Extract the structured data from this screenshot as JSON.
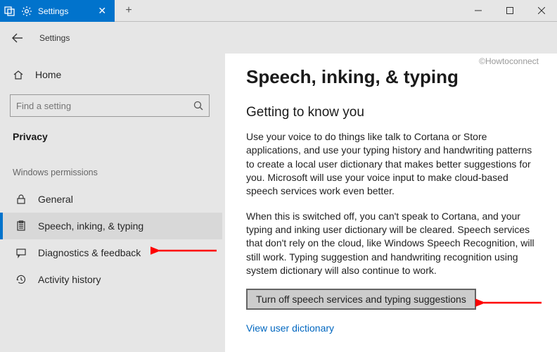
{
  "titlebar": {
    "tab_label": "Settings",
    "new_tab_symbol": "+",
    "min_symbol": "—",
    "max_symbol": "☐",
    "close_symbol": "✕",
    "tab_close_symbol": "✕"
  },
  "topbar": {
    "app_label": "Settings"
  },
  "sidebar": {
    "home_label": "Home",
    "search_placeholder": "Find a setting",
    "section_title": "Privacy",
    "group_label": "Windows permissions",
    "items": [
      {
        "label": "General"
      },
      {
        "label": "Speech, inking, & typing"
      },
      {
        "label": "Diagnostics & feedback"
      },
      {
        "label": "Activity history"
      }
    ]
  },
  "content": {
    "watermark": "©Howtoconnect",
    "h1": "Speech, inking, & typing",
    "h2": "Getting to know you",
    "p1": "Use your voice to do things like talk to Cortana or Store applications, and use your typing history and handwriting patterns to create a local user dictionary that makes better suggestions for you. Microsoft will use your voice input to make cloud-based speech services work even better.",
    "p2": "When this is switched off, you can't speak to Cortana, and your typing and inking user dictionary will be cleared. Speech services that don't rely on the cloud, like Windows Speech Recognition, will still work. Typing suggestion and handwriting recognition using system dictionary will also continue to work.",
    "button_label": "Turn off speech services and typing suggestions",
    "link_label": "View user dictionary"
  }
}
